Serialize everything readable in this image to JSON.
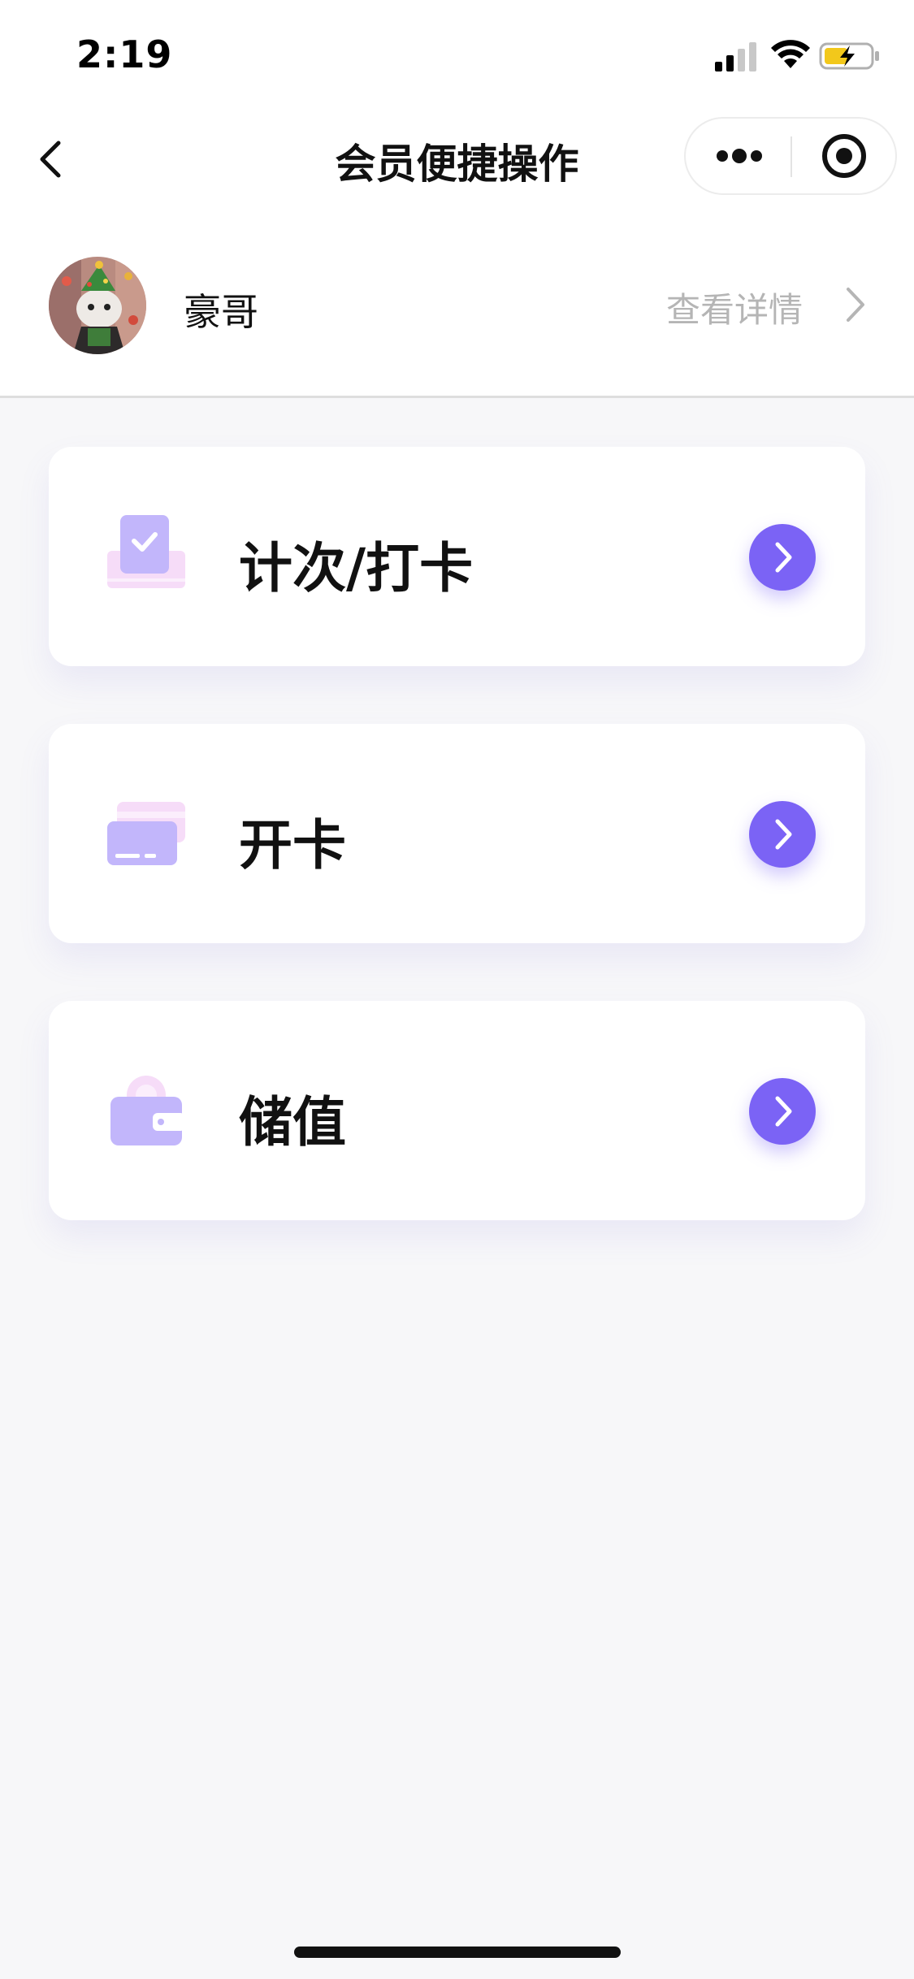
{
  "status_bar": {
    "time": "2:19"
  },
  "nav": {
    "title": "会员便捷操作"
  },
  "profile": {
    "name": "豪哥",
    "details_label": "查看详情"
  },
  "actions": [
    {
      "label": "计次/打卡",
      "icon": "checkin-icon"
    },
    {
      "label": "开卡",
      "icon": "card-icon"
    },
    {
      "label": "储值",
      "icon": "wallet-icon"
    }
  ],
  "colors": {
    "accent": "#7b63f5",
    "icon_purple": "#c2b6fb",
    "icon_pink": "#f6dcf8",
    "secondary_text": "#b5b5b5"
  }
}
